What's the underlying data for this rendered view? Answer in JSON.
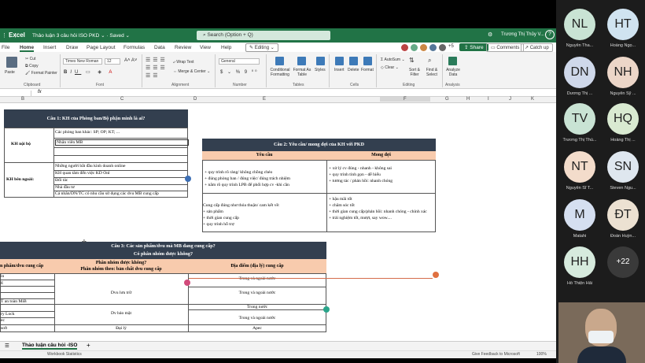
{
  "titlebar": {
    "app": "Excel",
    "doc_title": "Thảo luận 3 câu hỏi ISO PKD",
    "doc_status": "Saved",
    "search_placeholder": "Search (Option + Q)",
    "user": "Trương Thị Thủy V..."
  },
  "menu": {
    "tabs": [
      "File",
      "Home",
      "Insert",
      "Draw",
      "Page Layout",
      "Formulas",
      "Data",
      "Review",
      "View",
      "Help"
    ],
    "editing": "Editing",
    "share": "Share",
    "comments": "Comments",
    "catchup": "Catch up",
    "extra_avatars": "+5"
  },
  "ribbon": {
    "paste": "Paste",
    "cut": "Cut",
    "copy": "Copy",
    "format_painter": "Format Painter",
    "clipboard": "Clipboard",
    "font_name": "Times New Roman",
    "font_size": "12",
    "font": "Font",
    "wrap_text": "Wrap Text",
    "merge_center": "Merge & Center",
    "alignment": "Alignment",
    "number_format": "General",
    "number": "Number",
    "conditional": "Conditional Formatting",
    "format_table": "Format As Table",
    "styles": "Styles",
    "tables": "Tables",
    "insert": "Insert",
    "delete": "Delete",
    "format": "Format",
    "cells": "Cells",
    "autosum": "AutoSum",
    "clear": "Clear",
    "sort": "Sort & Filter",
    "find": "Find & Select",
    "editing": "Editing",
    "analyze": "Analyze Data",
    "analysis": "Analysis"
  },
  "columns": [
    "B",
    "C",
    "D",
    "E",
    "F",
    "G",
    "H",
    "I",
    "J",
    "K"
  ],
  "q1": {
    "title": "Câu 1: KH của Phòng ban/Bộ phận mình là ai?",
    "internal": "KH nội bộ",
    "internal_items": [
      "Các phòng ban khác: SP; OP; KT; ...",
      "Nhân viên MB",
      "",
      ""
    ],
    "external": "KH bên ngoài:",
    "external_items": [
      "Những người bắt đầu kinh doanh online",
      "KH quan tâm đến việc KD Onl",
      "Đối tác",
      "Nhà đầu tư",
      "Cá nhân/DN/TC có nhu cầu sử dụng các dvu MB cung cấp"
    ]
  },
  "q2": {
    "title": "Câu 2: Yêu cầu/ mong đợi của KH với PKD",
    "col_req": "Yêu cầu",
    "col_exp": "Mong đợi",
    "r1_req": [
      "+ quy trình rõ ràng/ không chồng chéo",
      "+ đúng phòng ban / đúng việc/ đúng trách nhiệm",
      "+ nắm rõ quy trình LPB để phối hợp cv -khi cần"
    ],
    "r1_exp": [
      "+ xử lý cv đúng - nhanh - không sai",
      "+ quy trình tinh gọn - dễ hiểu",
      "+ tương tác / phản hồi: nhanh chóng"
    ],
    "r2_req": [
      "Cung cấp đúng như thỏa thuận/ cam kết về:",
      "+ sản phẩm",
      "+ thời gian cung cấp",
      "+ quy trình hỗ trợ"
    ],
    "r2_exp": [
      "+ hậu mãi tốt",
      "+ chăm sóc tốt",
      "+ thời gian cung cấp/phản hồi: nhanh chóng - chính xác",
      "+ trải nghiệm tốt, mượt, say wow...."
    ]
  },
  "q3": {
    "title": "Câu 3: Các sản phẩm/dvu mà MB đang cung cấp?",
    "subtitle": "Có phân nhóm được không?",
    "col_product": "n phẩm/dvu cung cấp",
    "col_group": "Phân nhóm được không?",
    "col_group_sub": "Phân nhóm theo: bản chất dvu cung cấp",
    "col_place": "Địa điểm (địa lý) cung cấp",
    "products": [
      "in",
      "g",
      "",
      "",
      "T an toàn MiB",
      "",
      "ry Lock",
      "ec",
      "soft"
    ],
    "groups": [
      "Dvu lưu trữ",
      "Dv bảo mật",
      "Đại lý"
    ],
    "places": [
      "Trong và ngoài nước",
      "Trong và ngoài nước",
      "Trong nước",
      "Trong và ngoài nước",
      "Apec"
    ]
  },
  "sheet_tab": "Thảo luận câu hỏi -ISO",
  "status": {
    "left": "Workbook Statistics",
    "feedback": "Give Feedback to Microsoft",
    "zoom": "100%"
  },
  "participants": [
    {
      "initials": "NL",
      "name": "Nguyễn Tha...",
      "color": "#c9e3d4"
    },
    {
      "initials": "HT",
      "name": "Hoàng Ngọ...",
      "color": "#d0e3f0"
    },
    {
      "initials": "DN",
      "name": "Dương Thị ...",
      "color": "#cfd8ea"
    },
    {
      "initials": "NH",
      "name": "Nguyễn Sỹ ...",
      "color": "#ecd6c8"
    },
    {
      "initials": "TV",
      "name": "Trương Thị Thủ...",
      "color": "#c9e3d4"
    },
    {
      "initials": "HQ",
      "name": "Hoàng Thị ...",
      "color": "#d9ead1"
    },
    {
      "initials": "NT",
      "name": "Nguyễn Sĩ T...",
      "color": "#f3dccb"
    },
    {
      "initials": "SN",
      "name": "Steven Ngu...",
      "color": "#dfe7ef"
    },
    {
      "initials": "M",
      "name": "Matahi",
      "color": "#d5dff0"
    },
    {
      "initials": "ĐT",
      "name": "Đoàn Huỳn...",
      "color": "#ece1d2"
    },
    {
      "initials": "HH",
      "name": "Hồ Thiện Hải",
      "color": "#d6eadd"
    },
    {
      "initials": "+22",
      "name": "",
      "color": "#3a3a3a"
    }
  ]
}
